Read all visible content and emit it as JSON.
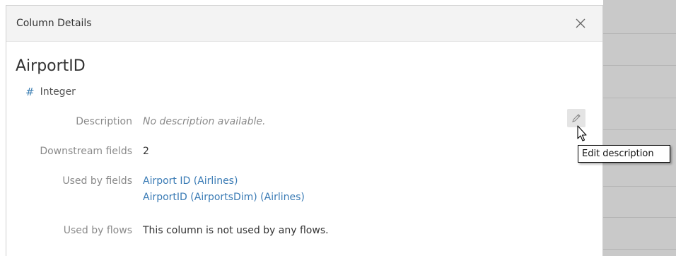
{
  "dialog": {
    "title": "Column Details",
    "close_icon": "close-icon"
  },
  "field": {
    "name": "AirportID",
    "type_icon": "hash-icon",
    "type": "Integer"
  },
  "details": {
    "description_label": "Description",
    "description_value": "No description available.",
    "downstream_label": "Downstream fields",
    "downstream_value": "2",
    "used_by_fields_label": "Used by fields",
    "used_by_fields": [
      "Airport ID (Airlines)",
      "AirportID (AirportsDim) (Airlines)"
    ],
    "used_by_flows_label": "Used by flows",
    "used_by_flows_value": "This column is not used by any flows."
  },
  "edit_button": {
    "icon": "pencil-icon"
  },
  "tooltip": {
    "text": "Edit description"
  },
  "colors": {
    "link": "#3a7bb5",
    "header_bg": "#f3f3f3",
    "type_icon": "#3d7fb3"
  }
}
